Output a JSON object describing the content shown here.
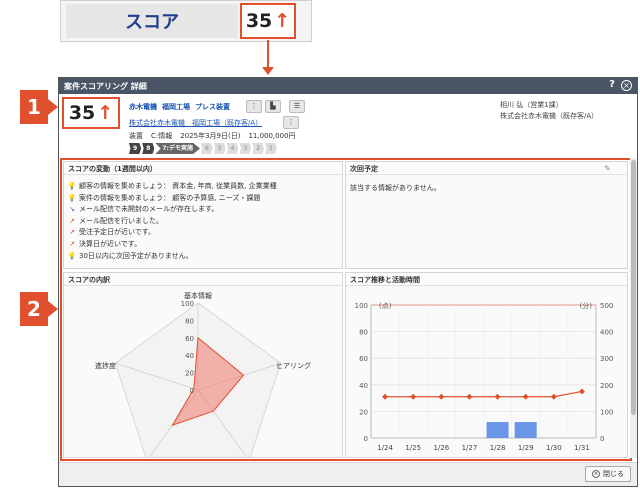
{
  "top_zoom": {
    "label": "スコア",
    "score": "35",
    "arrow": "↑"
  },
  "badges": {
    "b1": "1",
    "b2": "2"
  },
  "window": {
    "title": "案件スコアリング 詳細",
    "help": "?",
    "close_x": "×"
  },
  "header": {
    "score": "35",
    "arrow": "↑",
    "company_short": "赤木電機",
    "factory": "福岡工場",
    "product": "プレス装置",
    "customer_link": "株式会社赤木電機　福岡工場（既存客/A）",
    "deal_type": "装置",
    "deal_stage": "C:情報",
    "deal_date": "2025年3月9日(日)",
    "deal_amount": "11,000,000円",
    "owner_name": "相川 弘（営業1課）",
    "owner_company": "株式会社赤木電機（既存客/A）",
    "button_icons": [
      "more-icon",
      "report-icon",
      "stack-icon",
      "more-icon"
    ]
  },
  "stages": [
    {
      "label": "9",
      "state": "done"
    },
    {
      "label": "8",
      "state": "done"
    },
    {
      "label": "7:デモ実施",
      "state": "cur"
    },
    {
      "label": "6",
      "state": "todo"
    },
    {
      "label": "5",
      "state": "todo"
    },
    {
      "label": "4",
      "state": "todo"
    },
    {
      "label": "3",
      "state": "todo"
    },
    {
      "label": "2",
      "state": "todo"
    },
    {
      "label": "1",
      "state": "todo"
    }
  ],
  "score_changes": {
    "title": "スコアの変動（1週間以内）",
    "items": [
      {
        "icon": "bulb-icon",
        "text": "顧客の情報を集めましょう： 資本金, 年商, 従業員数, 企業業種"
      },
      {
        "icon": "bulb-icon",
        "text": "案件の情報を集めましょう： 顧客の予算感, ニーズ・課題"
      },
      {
        "icon": "trend-down-icon",
        "text": "メール配信で未開封のメールが存在します。"
      },
      {
        "icon": "trend-up-icon",
        "text": "メール配信を行いました。"
      },
      {
        "icon": "trend-up-icon",
        "text": "受注予定日が近いです。"
      },
      {
        "icon": "trend-up-icon",
        "text": "決算日が近いです。"
      },
      {
        "icon": "bulb-icon",
        "text": "30日以内に次回予定がありません。"
      }
    ]
  },
  "next_schedule": {
    "title": "次回予定",
    "text": "該当する情報がありません。"
  },
  "breakdown": {
    "title": "スコアの内訳"
  },
  "trend": {
    "title": "スコア推移と活動時間"
  },
  "footer": {
    "close_label": "閉じる"
  },
  "colors": {
    "accent": "#e0502c",
    "link": "#1a55b5",
    "titlebar": "#4a5566",
    "bar": "#6b96e8",
    "line": "#e0502c"
  },
  "chart_data": [
    {
      "type": "radar",
      "title": "スコアの内訳",
      "axes": [
        "基本情報",
        "ヒアリング",
        "",
        "",
        "進捗度"
      ],
      "ticks": [
        0,
        20,
        40,
        60,
        80,
        100
      ],
      "range": [
        0,
        100
      ],
      "series": [
        {
          "values": [
            60,
            55,
            30,
            50,
            5
          ]
        }
      ]
    },
    {
      "type": "line+bar",
      "title": "スコア推移と活動時間",
      "categories": [
        "1/24",
        "1/25",
        "1/26",
        "1/27",
        "1/28",
        "1/29",
        "1/30",
        "1/31"
      ],
      "y_left": {
        "label": "(点)",
        "range": [
          0,
          100
        ],
        "ticks": [
          0,
          20,
          40,
          60,
          80,
          100
        ]
      },
      "y_right": {
        "label": "(分)",
        "range": [
          0,
          500
        ],
        "ticks": [
          0,
          100,
          200,
          300,
          400,
          500
        ]
      },
      "series": [
        {
          "type": "line",
          "axis": "left",
          "values": [
            31,
            31,
            31,
            31,
            31,
            31,
            31,
            35
          ]
        },
        {
          "type": "bar",
          "axis": "right",
          "values": [
            0,
            0,
            0,
            0,
            60,
            60,
            0,
            0
          ]
        }
      ]
    }
  ]
}
